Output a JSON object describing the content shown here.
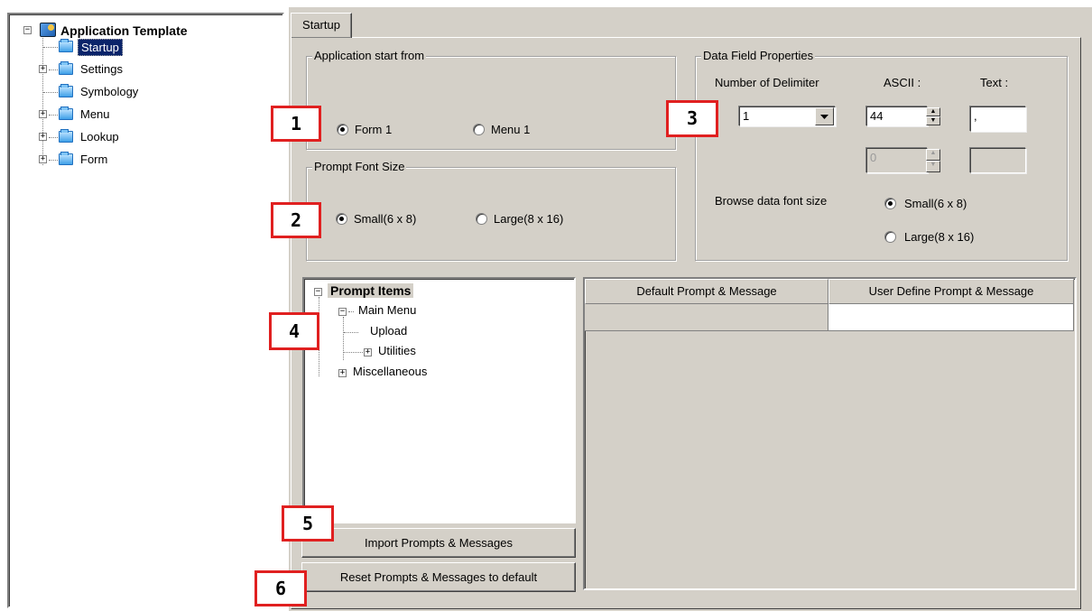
{
  "left_tree": {
    "root_label": "Application Template",
    "items": [
      {
        "label": "Startup",
        "selected": true,
        "expandable": false
      },
      {
        "label": "Settings",
        "expandable": true
      },
      {
        "label": "Symbology",
        "expandable": false
      },
      {
        "label": "Menu",
        "expandable": true
      },
      {
        "label": "Lookup",
        "expandable": true
      },
      {
        "label": "Form",
        "expandable": true
      }
    ]
  },
  "tab": {
    "label": "Startup"
  },
  "app_start": {
    "title": "Application start from",
    "options": [
      {
        "label": "Form 1",
        "checked": true
      },
      {
        "label": "Menu 1",
        "checked": false
      }
    ]
  },
  "prompt_font": {
    "title": "Prompt Font Size",
    "options": [
      {
        "label": "Small(6 x 8)",
        "checked": true
      },
      {
        "label": "Large(8 x 16)",
        "checked": false
      }
    ]
  },
  "data_field": {
    "title": "Data Field Properties",
    "delimiter_label": "Number of Delimiter",
    "delimiter_value": "1",
    "ascii_label": "ASCII :",
    "text_label": "Text :",
    "ascii_1": "44",
    "text_1": ",",
    "ascii_2": "0",
    "text_2": "",
    "browse_label": "Browse data font size",
    "browse_options": [
      {
        "label": "Small(6 x 8)",
        "checked": true
      },
      {
        "label": "Large(8 x 16)",
        "checked": false
      }
    ]
  },
  "prompt_tree": {
    "root": "Prompt Items",
    "main_menu": "Main Menu",
    "upload": "Upload",
    "utilities": "Utilities",
    "misc": "Miscellaneous"
  },
  "grid": {
    "col1": "Default Prompt & Message",
    "col2": "User Define Prompt & Message"
  },
  "buttons": {
    "import": "Import Prompts & Messages",
    "reset": "Reset Prompts & Messages to default"
  },
  "callouts": [
    "1",
    "2",
    "3",
    "4",
    "5",
    "6"
  ],
  "colors": {
    "panel": "#d4d0c8",
    "selection": "#0a246a",
    "callout_border": "#e02020"
  }
}
